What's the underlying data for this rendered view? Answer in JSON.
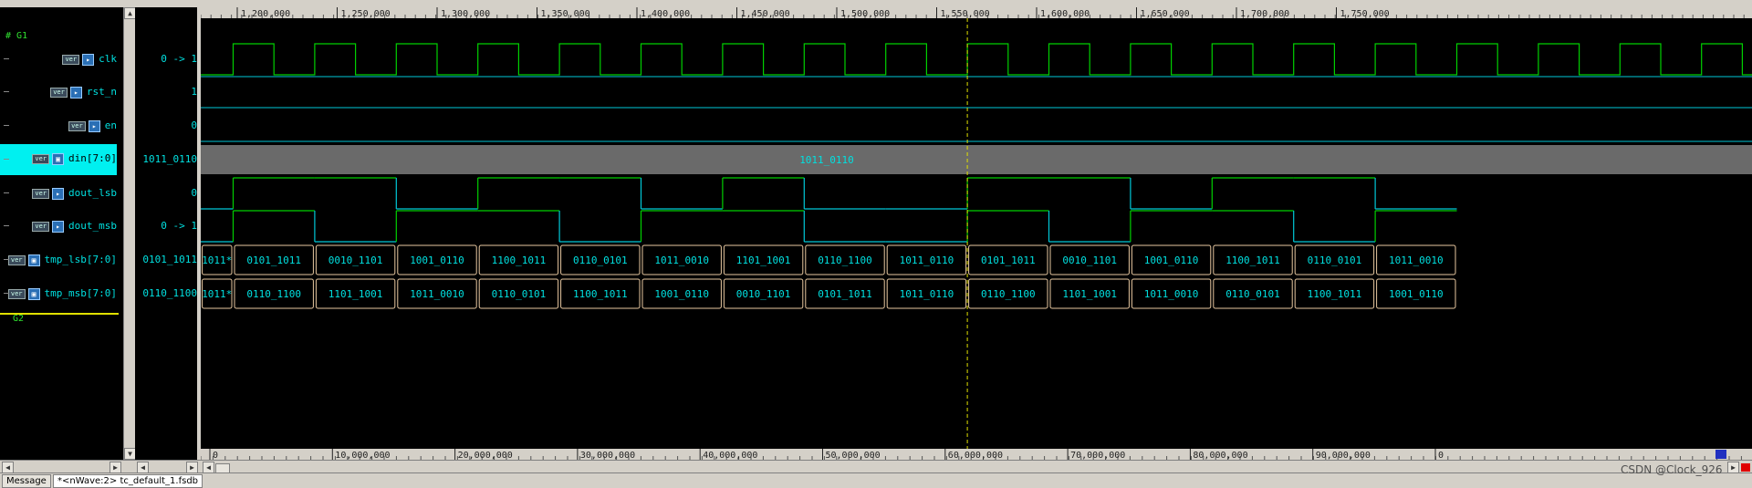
{
  "groups": [
    {
      "name": "G1"
    },
    {
      "name": "G2"
    }
  ],
  "signals": [
    {
      "name": "clk",
      "badge": "ver",
      "icon": "input-port-icon",
      "value": "0 -> 1",
      "kind": "clock"
    },
    {
      "name": "rst_n",
      "badge": "ver",
      "icon": "input-port-icon",
      "value": "1",
      "kind": "bit"
    },
    {
      "name": "en",
      "badge": "ver",
      "icon": "input-port-icon",
      "value": "0",
      "kind": "bit"
    },
    {
      "name": "din[7:0]",
      "badge": "ver",
      "icon": "bus-input-icon",
      "value": "1011_0110",
      "kind": "const-bus",
      "bus_label": "1011_0110",
      "selected": true
    },
    {
      "name": "dout_lsb",
      "badge": "ver",
      "icon": "output-port-icon",
      "value": "0",
      "kind": "bit"
    },
    {
      "name": "dout_msb",
      "badge": "ver",
      "icon": "output-port-icon",
      "value": "0 -> 1",
      "kind": "bit"
    },
    {
      "name": "tmp_lsb[7:0]",
      "badge": "ver",
      "icon": "register-icon",
      "value": "0101_1011",
      "kind": "bus"
    },
    {
      "name": "tmp_msb[7:0]",
      "badge": "ver",
      "icon": "register-icon",
      "value": "0110_1100",
      "kind": "bus"
    }
  ],
  "top_ruler": [
    "1,200,000",
    "1,250,000",
    "1,300,000",
    "1,350,000",
    "1,400,000",
    "1,450,000",
    "1,500,000",
    "1,550,000",
    "1,600,000",
    "1,650,000",
    "1,700,000",
    "1,750,000"
  ],
  "bottom_ruler": [
    "0",
    "10,000,000",
    "20,000,000",
    "30,000,000",
    "40,000,000",
    "50,000,000",
    "60,000,000",
    "70,000,000",
    "80,000,000",
    "90,000,000",
    "0"
  ],
  "tmp_lsb_segments": [
    "1011*",
    "0101_1011",
    "0010_1101",
    "1001_0110",
    "1100_1011",
    "0110_0101",
    "1011_0010",
    "1101_1001",
    "0110_1100",
    "1011_0110",
    "0101_1011",
    "0010_1101",
    "1001_0110",
    "1100_1011",
    "0110_0101",
    "1011_0010"
  ],
  "tmp_msb_segments": [
    "1011*",
    "0110_1100",
    "1101_1001",
    "1011_0010",
    "0110_0101",
    "1100_1011",
    "1001_0110",
    "0010_1101",
    "0101_1011",
    "1011_0110",
    "0110_1100",
    "1101_1001",
    "1011_0010",
    "0110_0101",
    "1100_1011",
    "1001_0110"
  ],
  "waves": {
    "clk_levels": [
      0,
      1,
      0,
      1,
      0,
      1,
      0,
      1,
      0,
      1,
      0,
      1,
      0,
      1,
      0,
      1,
      0,
      1,
      0,
      1,
      0,
      1,
      0,
      1,
      0,
      1,
      0,
      1,
      0,
      1,
      0,
      1
    ],
    "rst_n_level": 1,
    "en_level": 0,
    "dout_lsb_levels": [
      0,
      1,
      1,
      0,
      1,
      1,
      0,
      1,
      0,
      0,
      1,
      1,
      0,
      1,
      1,
      0
    ],
    "dout_msb_levels": [
      0,
      1,
      0,
      1,
      1,
      0,
      1,
      1,
      0,
      0,
      1,
      0,
      1,
      1,
      0,
      1
    ]
  },
  "tabs": [
    {
      "label": "Message"
    },
    {
      "label": "*<nWave:2> tc_default_1.fsdb"
    }
  ],
  "watermark": "CSDN @Clock_926",
  "colors": {
    "wave_green": "#00d000",
    "wave_cyan": "#00c8d8",
    "cursor_yellow": "#e0e000",
    "bus_border": "#e8c8a0",
    "bus_text": "#00e0e0",
    "selected_bg": "#00f0f0"
  }
}
